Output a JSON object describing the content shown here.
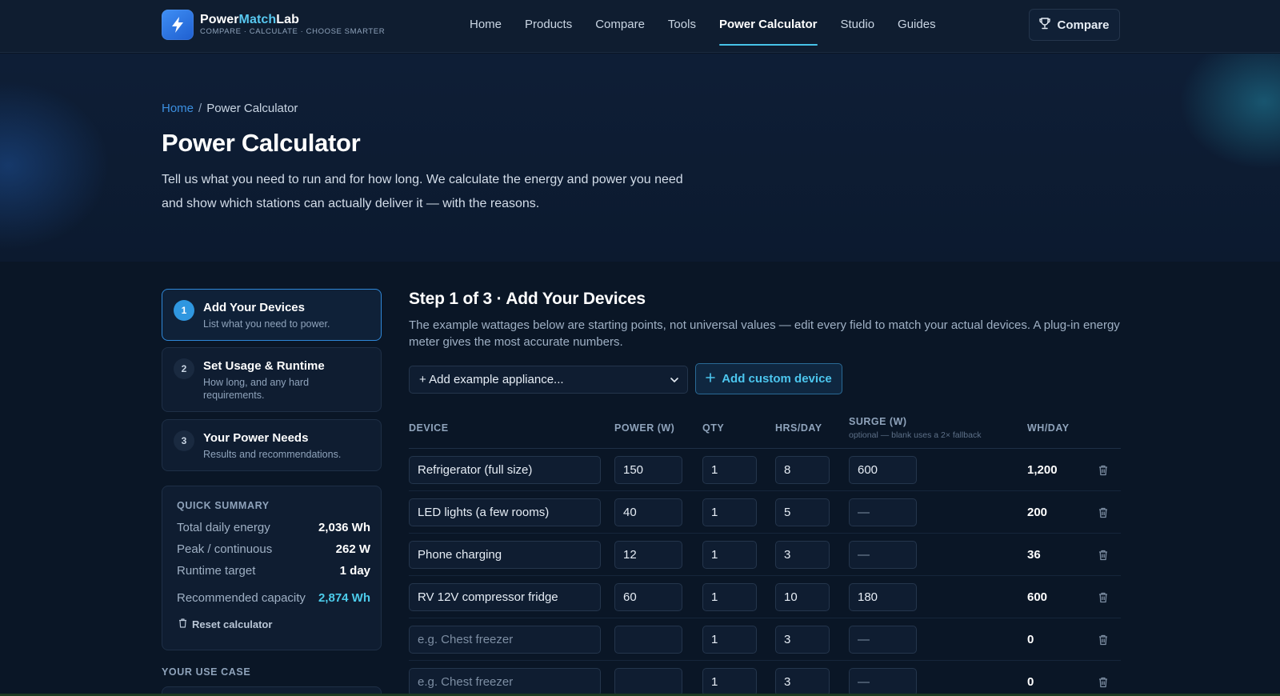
{
  "brand": {
    "name_part1": "Power",
    "name_accent": "Match",
    "name_part2": "Lab",
    "tagline": "COMPARE · CALCULATE · CHOOSE SMARTER",
    "icon": "lightning-bolt-icon"
  },
  "nav": {
    "items": [
      "Home",
      "Products",
      "Compare",
      "Tools",
      "Power Calculator",
      "Studio",
      "Guides"
    ],
    "active": "Power Calculator",
    "compare_button": "Compare",
    "compare_icon": "trophy-icon"
  },
  "breadcrumb": {
    "home": "Home",
    "current": "Power Calculator"
  },
  "hero": {
    "title": "Power Calculator",
    "intro_line1": "Tell us what you need to run and for how long. We calculate the energy and power you need",
    "intro_line2": "and show which stations can actually deliver it — with the reasons."
  },
  "steps": [
    {
      "num": "1",
      "title": "Add Your Devices",
      "sub": "List what you need to power.",
      "active": true
    },
    {
      "num": "2",
      "title": "Set Usage & Runtime",
      "sub": "How long, and any hard requirements.",
      "active": false
    },
    {
      "num": "3",
      "title": "Your Power Needs",
      "sub": "Results and recommendations.",
      "active": false
    }
  ],
  "summary": {
    "heading": "QUICK SUMMARY",
    "rows": [
      {
        "label": "Total daily energy",
        "value": "2,036 Wh"
      },
      {
        "label": "Peak / continuous",
        "value": "262 W"
      },
      {
        "label": "Runtime target",
        "value": "1 day"
      },
      {
        "label": "Recommended capacity",
        "value": "2,874 Wh"
      }
    ],
    "reset": "Reset calculator"
  },
  "use_case_heading": "YOUR USE CASE",
  "main": {
    "heading": "Step 1 of 3 · Add Your Devices",
    "description": "The example wattages below are starting points, not universal values — edit every field to match your actual devices. A plug-in energy meter gives the most accurate numbers.",
    "select_label": "+ Add example appliance...",
    "custom_button": "Add custom device"
  },
  "table": {
    "headers": {
      "device": "DEVICE",
      "power": "POWER (W)",
      "qty": "QTY",
      "hrs": "HRS/DAY",
      "surge": "SURGE (W)",
      "surge_note": "optional — blank uses a 2× fallback",
      "whday": "WH/DAY"
    },
    "rows": [
      {
        "device": "Refrigerator (full size)",
        "power": "150",
        "qty": "1",
        "hrs": "8",
        "surge": "600",
        "whday": "1,200"
      },
      {
        "device": "LED lights (a few rooms)",
        "power": "40",
        "qty": "1",
        "hrs": "5",
        "surge": "—",
        "whday": "200"
      },
      {
        "device": "Phone charging",
        "power": "12",
        "qty": "1",
        "hrs": "3",
        "surge": "—",
        "whday": "36"
      },
      {
        "device": "RV 12V compressor fridge",
        "power": "60",
        "qty": "1",
        "hrs": "10",
        "surge": "180",
        "whday": "600"
      },
      {
        "device": "e.g. Chest freezer",
        "power": "",
        "qty": "1",
        "hrs": "3",
        "surge": "—",
        "whday": "0"
      },
      {
        "device": "e.g. Chest freezer",
        "power": "",
        "qty": "1",
        "hrs": "3",
        "surge": "—",
        "whday": "0"
      }
    ]
  },
  "colors": {
    "background": "#0a1626",
    "header": "#0f1d30",
    "accent": "#47c3e8",
    "link": "#3b8fe0",
    "active_step": "#2f97e0"
  }
}
